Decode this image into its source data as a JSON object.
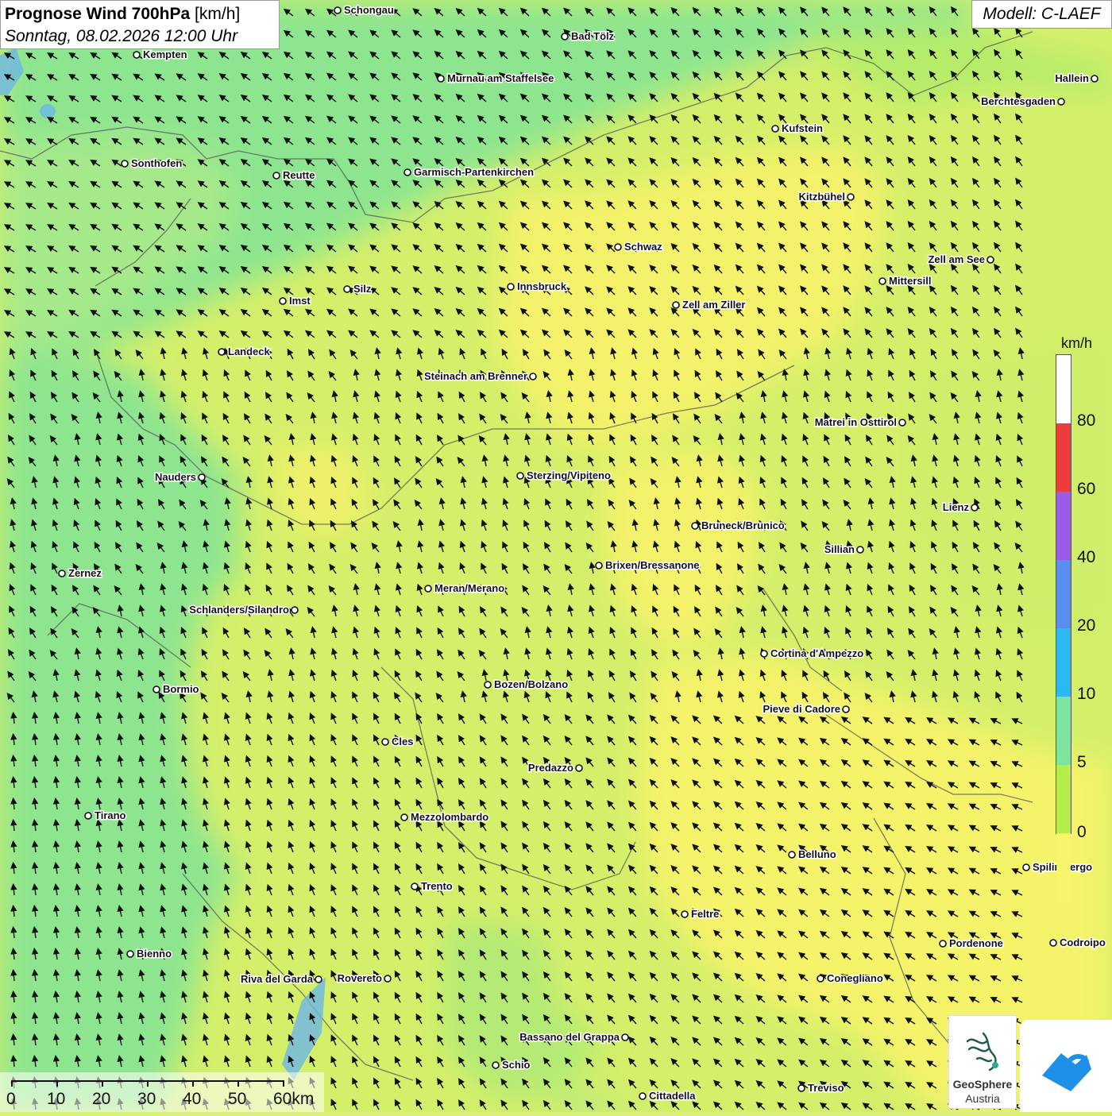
{
  "header": {
    "title_bold": "Prognose Wind 700hPa",
    "title_unit": "[km/h]",
    "datetime": "Sonntag, 08.02.2026 12:00 Uhr"
  },
  "model_label": "Modell: C-LAEF",
  "legend": {
    "unit": "km/h",
    "ticks": [
      "80",
      "60",
      "40",
      "20",
      "10",
      "5",
      "0"
    ],
    "colors": [
      "#ee3b3b",
      "#9b5de5",
      "#5b8def",
      "#2db8ef",
      "#7fe3a0",
      "#b5ee4a",
      "#f6f56b"
    ],
    "top_color": "#ffffff"
  },
  "scale": {
    "labels": [
      "0",
      "10",
      "20",
      "30",
      "40",
      "50",
      "60km"
    ]
  },
  "logos": {
    "geosphere_line1": "GeoSphere",
    "geosphere_line2": "Austria"
  },
  "cities": [
    {
      "name": "Schongau"
    },
    {
      "name": "Bad Tölz"
    },
    {
      "name": "Kempten"
    },
    {
      "name": "Murnau am Staffelsee"
    },
    {
      "name": "Hallein"
    },
    {
      "name": "Berchtesgaden"
    },
    {
      "name": "Kufstein"
    },
    {
      "name": "Sonthofen"
    },
    {
      "name": "Reutte"
    },
    {
      "name": "Garmisch-Partenkirchen"
    },
    {
      "name": "Kitzbühel"
    },
    {
      "name": "Schwaz"
    },
    {
      "name": "Zell am See"
    },
    {
      "name": "Mittersill"
    },
    {
      "name": "Silz"
    },
    {
      "name": "Innsbruck"
    },
    {
      "name": "Imst"
    },
    {
      "name": "Zell am Ziller"
    },
    {
      "name": "Landeck"
    },
    {
      "name": "Steinach am Brenner"
    },
    {
      "name": "Matrei in Osttirol"
    },
    {
      "name": "Nauders"
    },
    {
      "name": "Sterzing/Vipiteno"
    },
    {
      "name": "Lienz"
    },
    {
      "name": "Bruneck/Brunico"
    },
    {
      "name": "Sillian"
    },
    {
      "name": "Zernez"
    },
    {
      "name": "Brixen/Bressanone"
    },
    {
      "name": "Meran/Merano"
    },
    {
      "name": "Schlanders/Silandro"
    },
    {
      "name": "Cortina d'Ampezzo"
    },
    {
      "name": "Bozen/Bolzano"
    },
    {
      "name": "Bormio"
    },
    {
      "name": "Pieve di Cadore"
    },
    {
      "name": "Cles"
    },
    {
      "name": "Predazzo"
    },
    {
      "name": "Tirano"
    },
    {
      "name": "Mezzolombardo"
    },
    {
      "name": "Belluno"
    },
    {
      "name": "Spilimbergo"
    },
    {
      "name": "Trento"
    },
    {
      "name": "Feltre"
    },
    {
      "name": "Pordenone"
    },
    {
      "name": "Codroipo"
    },
    {
      "name": "Bienno"
    },
    {
      "name": "Riva del Garda"
    },
    {
      "name": "Rovereto"
    },
    {
      "name": "Conegliano"
    },
    {
      "name": "Bassano del Grappa"
    },
    {
      "name": "Schio"
    },
    {
      "name": "Treviso"
    },
    {
      "name": "Cittadella"
    }
  ]
}
